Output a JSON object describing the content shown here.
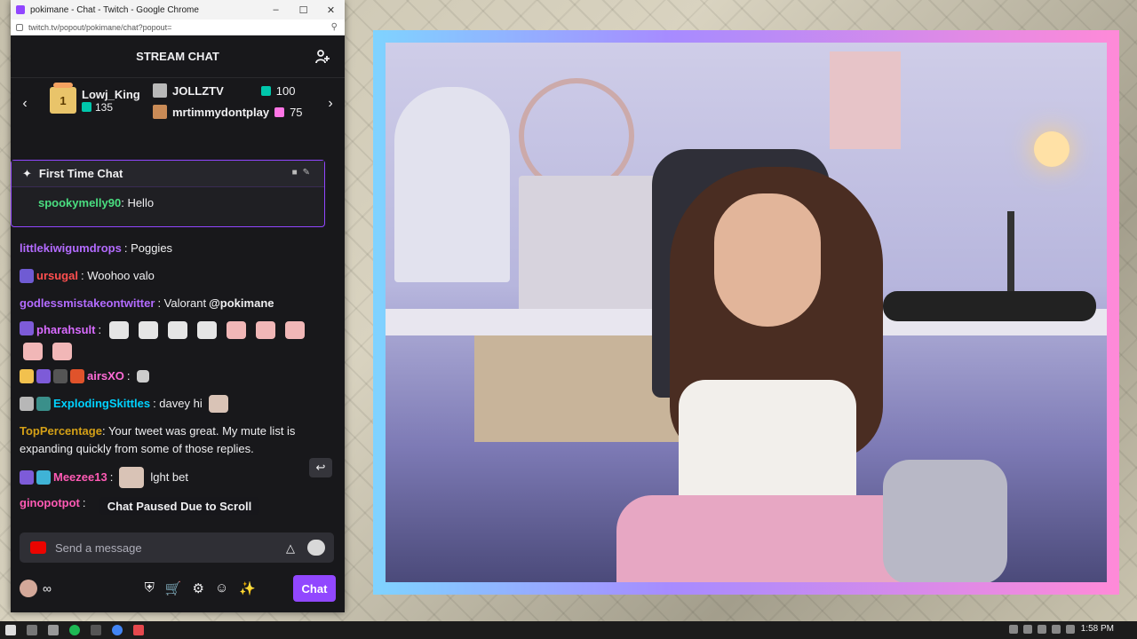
{
  "window": {
    "title": "pokimane - Chat - Twitch - Google Chrome",
    "url": "twitch.tv/popout/pokimane/chat?popout="
  },
  "chat": {
    "header": "STREAM CHAT",
    "leaderboard": {
      "first_name": "Lowj_King",
      "first_count": "135",
      "first_rank": "1",
      "second_name": "JOLLZTV",
      "second_count": "100",
      "third_name": "mrtimmydontplay",
      "third_count": "75"
    },
    "first_time_chat": {
      "title": "First Time Chat",
      "user": "spookymelly90",
      "text": ": Hello"
    },
    "messages": [
      {
        "user": "littlekiwigumdrops",
        "color": "#b36bff",
        "text": ": Poggies"
      },
      {
        "user": "ursugal",
        "color": "#ff4f4f",
        "text": ": Woohoo valo"
      },
      {
        "user": "godlessmistakeontwitter",
        "color": "#b36bff",
        "text": ": Valorant ",
        "mention": "@pokimane"
      },
      {
        "user": "pharahsult",
        "color": "#d86bff",
        "text": ":"
      },
      {
        "user": "airsXO",
        "color": "#ff6bd6",
        "text": ":"
      },
      {
        "user": "ExplodingSkittles",
        "color": "#00d2ff",
        "text": ": davey hi"
      },
      {
        "user": "TopPercentage",
        "color": "#d4a017",
        "text": ": Your tweet was great. My mute list is",
        "text2": "expanding quickly from some of those replies."
      },
      {
        "user": "Meezee13",
        "color": "#ff5ab4",
        "text": ":",
        "text_after": "lght bet"
      },
      {
        "user": "ginopotpot",
        "color": "#ff5ab4",
        "text": ":"
      }
    ],
    "paused_label": "Chat Paused Due to Scroll",
    "input_placeholder": "Send a message",
    "infinity": "∞",
    "chat_button": "Chat"
  },
  "taskbar": {
    "clock": "1:58 PM"
  },
  "colors": {
    "accent": "#9147ff",
    "chat_bg": "#18181b",
    "first_chat_user": "#4ade80"
  }
}
